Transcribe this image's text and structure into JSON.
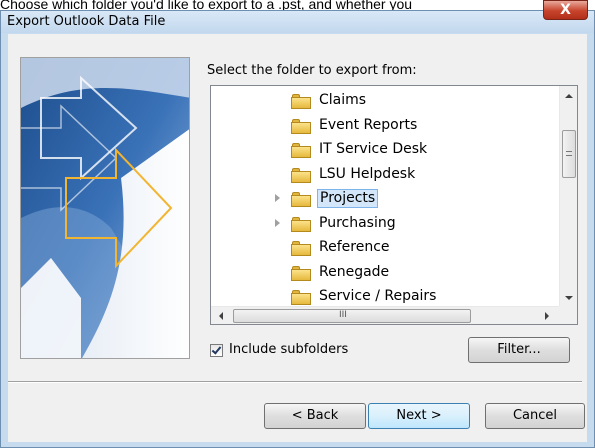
{
  "caption": "Choose which folder you'd like to export to a .pst, and whether you",
  "window": {
    "title": "Export Outlook Data File",
    "close_symbol": "X"
  },
  "prompt_label": "Select the folder to export from:",
  "folders": [
    {
      "label": "Claims",
      "expander": false,
      "selected": false
    },
    {
      "label": "Event Reports",
      "expander": false,
      "selected": false
    },
    {
      "label": "IT Service Desk",
      "expander": false,
      "selected": false
    },
    {
      "label": "LSU Helpdesk",
      "expander": false,
      "selected": false
    },
    {
      "label": "Projects",
      "expander": true,
      "selected": true
    },
    {
      "label": "Purchasing",
      "expander": true,
      "selected": false
    },
    {
      "label": "Reference",
      "expander": false,
      "selected": false
    },
    {
      "label": "Renegade",
      "expander": false,
      "selected": false
    },
    {
      "label": "Service / Repairs",
      "expander": false,
      "selected": false
    }
  ],
  "hscroll_grip": "III",
  "include_subfolders": {
    "label": "Include subfolders",
    "checked": true
  },
  "buttons": {
    "filter": "Filter...",
    "back": "< Back",
    "next": "Next >",
    "cancel": "Cancel"
  },
  "colors": {
    "accent_arrow": "#f2b531",
    "selection_bg": "#d3e6fa",
    "selection_border": "#7eb4ea",
    "window_frame": "#c7dbee"
  },
  "icons": {
    "folder": "folder-icon",
    "expander": "tree-expander-icon",
    "wizard_art": "export-arrows-art"
  }
}
